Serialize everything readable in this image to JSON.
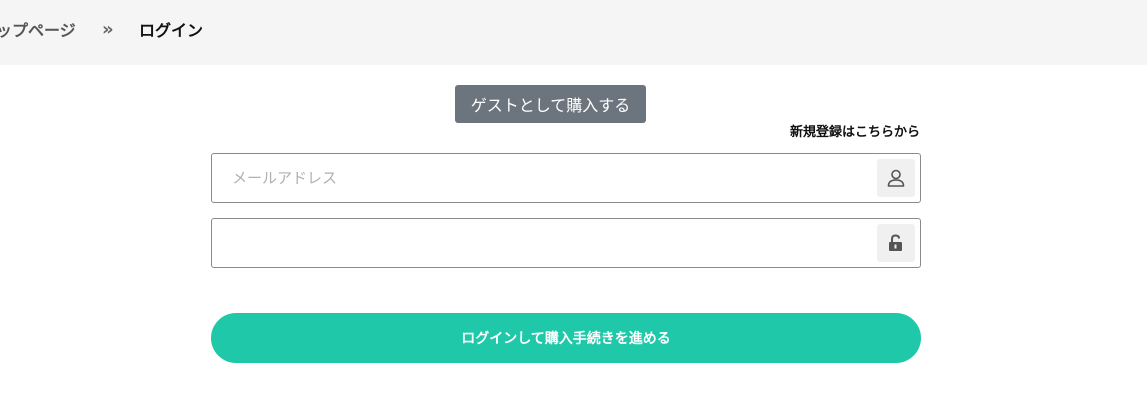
{
  "breadcrumb": {
    "home_label": "ップページ",
    "separator": "»",
    "current_label": "ログイン"
  },
  "login": {
    "guest_button_label": "ゲストとして購入する",
    "register_link_label": "新規登録はこちらから",
    "email_placeholder": "メールアドレス",
    "email_value": "",
    "password_value": "",
    "email_icon": "user-icon",
    "password_icon": "unlock-icon",
    "submit_label": "ログインして購入手続きを進める"
  },
  "colors": {
    "accent": "#1ec8a8",
    "guest_button": "#6c757d",
    "breadcrumb_bg": "#f5f5f5"
  }
}
